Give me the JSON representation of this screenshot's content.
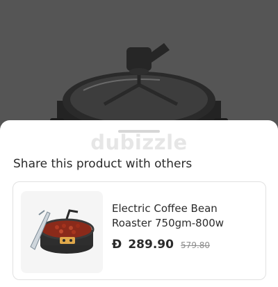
{
  "colors": {
    "backdrop": "#555555",
    "sheet": "#ffffff",
    "text_primary": "#2b2b2b",
    "text_muted": "#8c8c8c",
    "watermark": "#e6e6e6",
    "card_border": "#e1e1e1"
  },
  "background": {
    "image_icon": "coffee-roaster-photo"
  },
  "sheet": {
    "watermark": "dubizzle",
    "title": "Share this product with others"
  },
  "product": {
    "name": "Electric Coffee Bean Roaster 750gm-800w",
    "currency_symbol": "Đ",
    "price": "289.90",
    "old_price": "579.80",
    "thumbnail_icon": "coffee-roaster-thumbnail"
  }
}
